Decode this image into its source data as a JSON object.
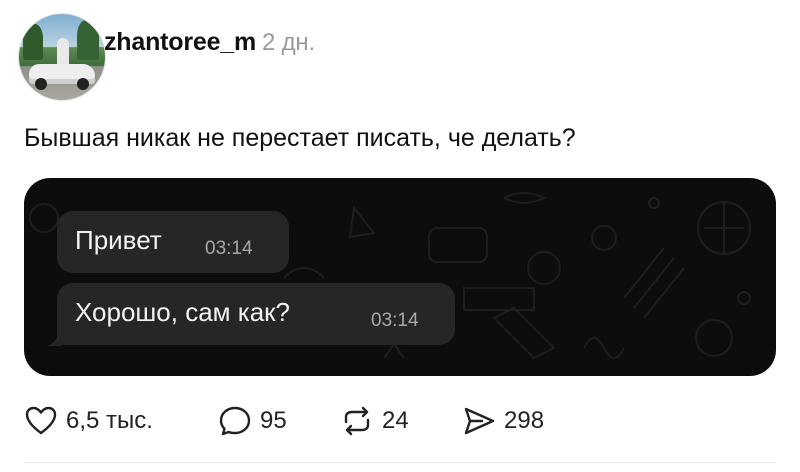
{
  "post": {
    "username": "zhantoree_m",
    "time_ago": "2 дн.",
    "caption": "Бывшая никак не перестает писать, че делать?",
    "chat": {
      "messages": [
        {
          "text": "Привет",
          "time": "03:14"
        },
        {
          "text": "Хорошо, сам как?",
          "time": "03:14"
        }
      ]
    },
    "actions": {
      "likes": "6,5 тыс.",
      "comments": "95",
      "reposts": "24",
      "shares": "298"
    }
  },
  "icons": {
    "like": "heart-outline-icon",
    "comment": "comment-bubble-icon",
    "repost": "repost-arrows-icon",
    "share": "send-paper-plane-icon"
  }
}
